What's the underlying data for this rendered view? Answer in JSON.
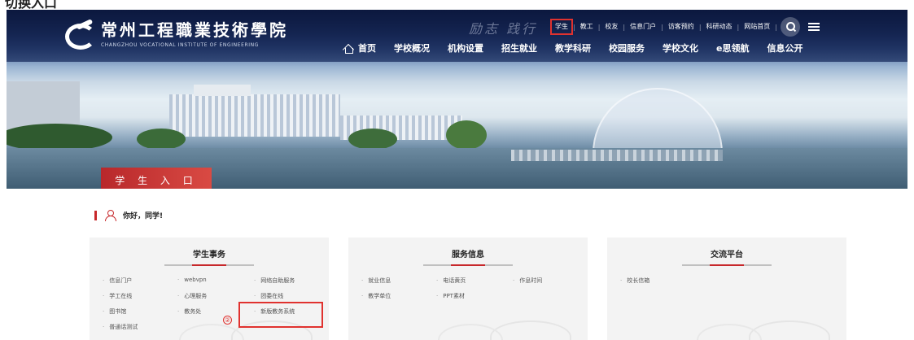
{
  "caption": "切换入口",
  "header": {
    "school_name": "常州工程職業技術學院",
    "school_name_en": "CHANGZHOU VOCATIONAL INSTITUTE OF ENGINEERING",
    "motto": "励志 践行",
    "quick_links": [
      "学生",
      "教工",
      "校友",
      "信息门户",
      "访客预约",
      "科研动态",
      "网站首页"
    ],
    "highlighted_quick_link": "学生",
    "nav": [
      "首页",
      "学校概况",
      "机构设置",
      "招生就业",
      "教学科研",
      "校园服务",
      "学校文化",
      "e思领航",
      "信息公开"
    ]
  },
  "banner": {
    "label": "学 生 入 口"
  },
  "greeting": "你好，同学!",
  "cards": [
    {
      "title": "学生事务",
      "links": [
        "信息门户",
        "webvpn",
        "网络自助服务",
        "学工在线",
        "心理服务",
        "团委在线",
        "图书馆",
        "教务处",
        "新版教务系统",
        "普通话测试"
      ]
    },
    {
      "title": "服务信息",
      "links": [
        "就业信息",
        "电话黄页",
        "作息时间",
        "教学单位",
        "PPT素材"
      ]
    },
    {
      "title": "交流平台",
      "links": [
        "校长信箱"
      ]
    }
  ],
  "annotation": {
    "step": "②",
    "target": "新版教务系统",
    "color": "#e0322f"
  },
  "colors": {
    "brand_red": "#c7282b",
    "nav_bg": "#142a5e"
  }
}
